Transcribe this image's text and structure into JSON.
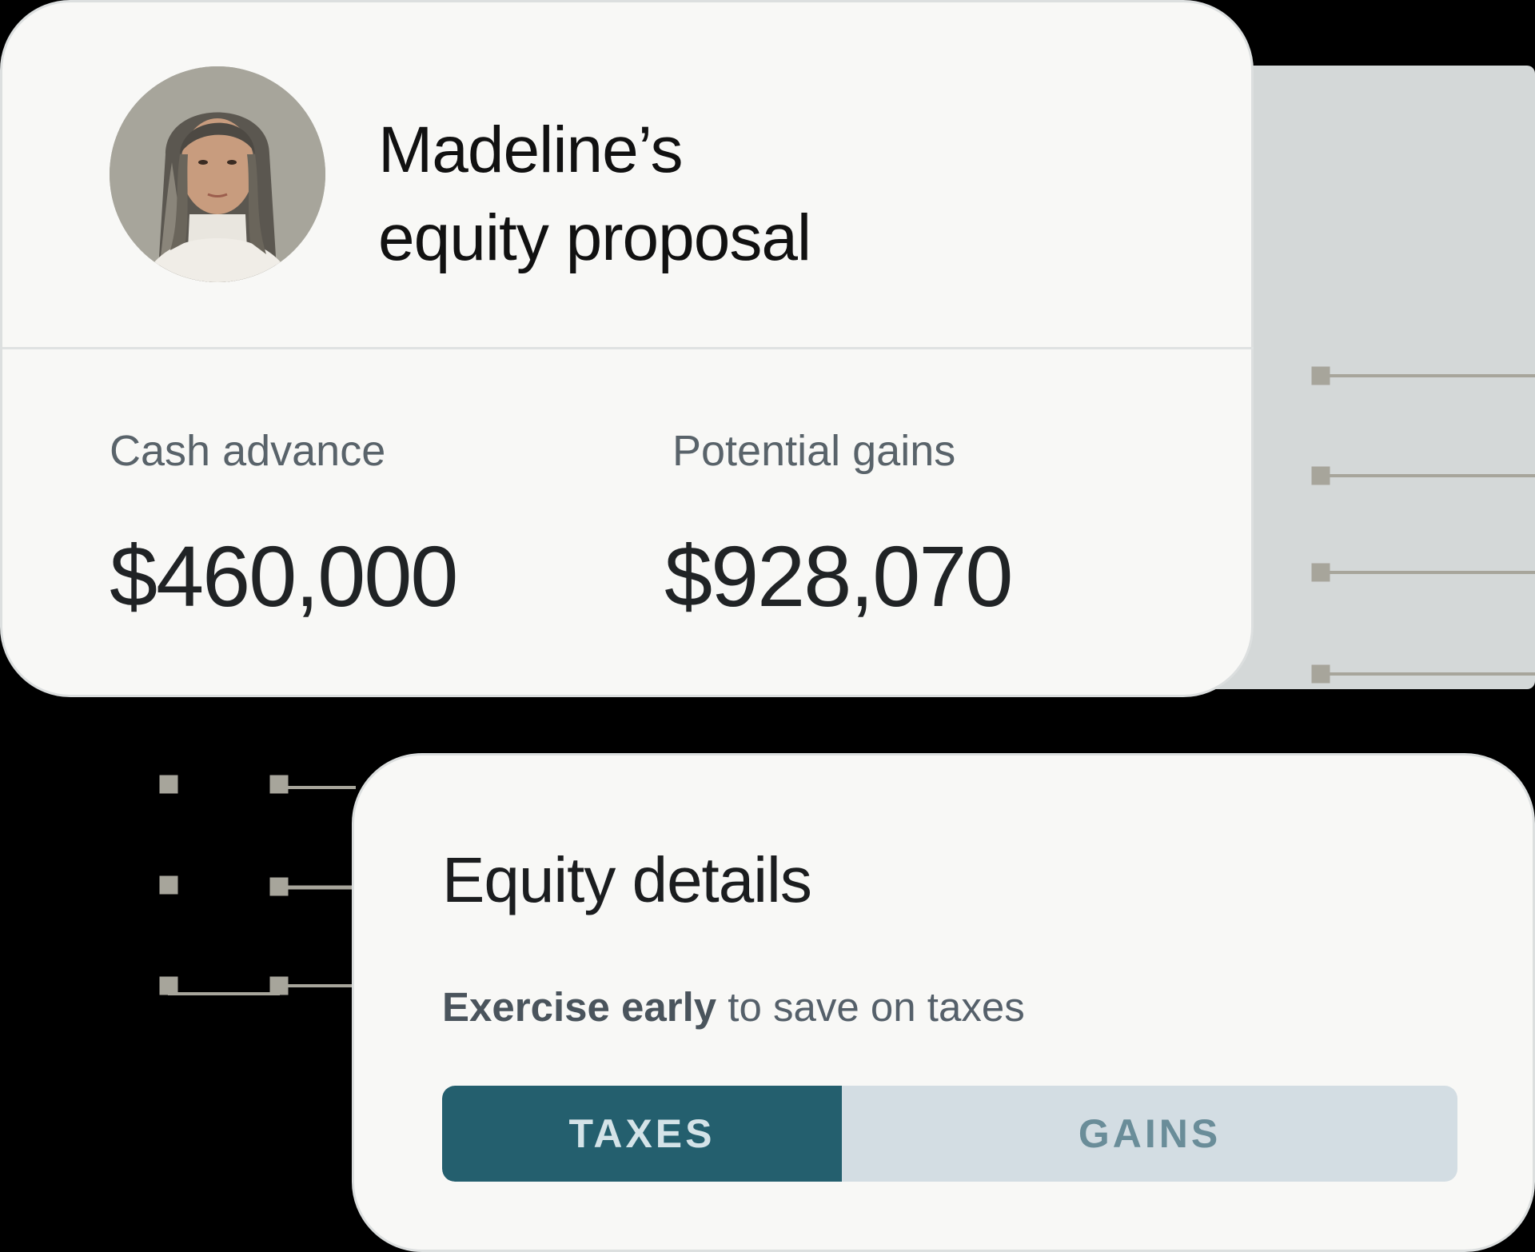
{
  "proposal": {
    "title_line1": "Madeline’s",
    "title_line2": "equity proposal",
    "avatar": "person-portrait"
  },
  "metrics": {
    "cash_advance_label": "Cash advance",
    "cash_advance_value": "$460,000",
    "potential_gains_label": "Potential gains",
    "potential_gains_value": "$928,070"
  },
  "details": {
    "title": "Equity details",
    "subtitle_bold": "Exercise early",
    "subtitle_rest": " to save on taxes",
    "toggle": {
      "taxes_label": "TAXES",
      "gains_label": "GAINS",
      "selected": "TAXES"
    }
  },
  "colors": {
    "background": "#000000",
    "card": "#f8f8f6",
    "accent": "#245f6e",
    "toggle_inactive": "#d3dde3",
    "connector": "#a7a59b"
  }
}
